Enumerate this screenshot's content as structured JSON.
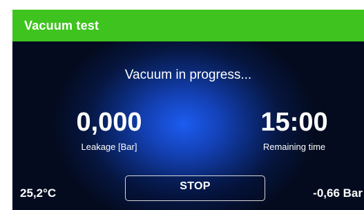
{
  "header": {
    "title": "Vacuum test"
  },
  "status": {
    "message": "Vacuum in progress..."
  },
  "readouts": {
    "leakage": {
      "value": "0,000",
      "label": "Leakage [Bar]"
    },
    "remaining_time": {
      "value": "15:00",
      "label": "Remaining time"
    }
  },
  "controls": {
    "stop_label": "STOP"
  },
  "footer": {
    "temperature": "25,2°C",
    "pressure": "-0,66 Bar"
  },
  "colors": {
    "title_bar": "#3fc41f",
    "background": "#000000",
    "glow": "#1c5cf0",
    "text": "#ffffff"
  }
}
